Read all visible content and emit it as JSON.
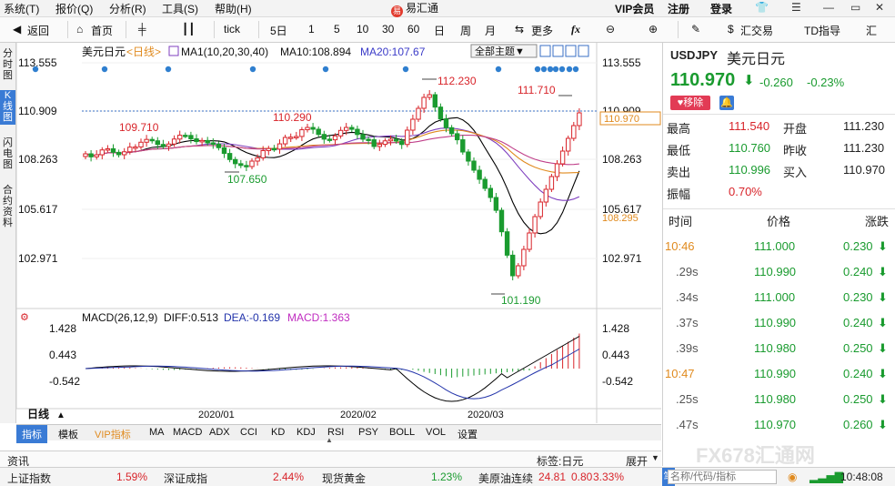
{
  "menubar": {
    "items": [
      "系统(T)",
      "报价(Q)",
      "分析(R)",
      "工具(S)",
      "帮助(H)"
    ],
    "brand": "易汇通",
    "vip": "VIP会员",
    "register": "注册",
    "login": "登录"
  },
  "toolbar": {
    "back": "返回",
    "home": "首页",
    "tick": "tick",
    "periods": [
      "5日",
      "1",
      "5",
      "10",
      "30",
      "60",
      "日",
      "周",
      "月"
    ],
    "more": "更多",
    "exchange": "汇交易",
    "td": "TD指导",
    "right_label": "汇"
  },
  "left_tabs": [
    "分时图",
    "K线图",
    "闪电图",
    "合约资料"
  ],
  "chart": {
    "title": "美元日元",
    "period": "<日线>",
    "ma_label": "MA1(10,20,30,40)",
    "ma10": "MA10:108.894",
    "ma20": "MA20:107.67",
    "theme_btn": "全部主题▼",
    "y_ticks": [
      "113.555",
      "110.909",
      "108.263",
      "105.617",
      "102.971"
    ],
    "current_price_tag": "110.970",
    "ma_tag": "108.295",
    "annotations": [
      "112.230",
      "111.710",
      "109.710",
      "110.290",
      "107.650",
      "101.190"
    ],
    "x_labels": [
      "2020/01",
      "2020/02",
      "2020/03"
    ],
    "macd_label": "MACD(26,12,9)",
    "macd_diff": "DIFF:0.513",
    "macd_dea": "DEA:-0.169",
    "macd_val": "MACD:1.363",
    "macd_ticks": [
      "1.428",
      "0.443",
      "-0.542"
    ],
    "day_tab": "日线",
    "colors": {
      "up": "#d8242a",
      "down": "#1a9b2f",
      "ma10": "#000000",
      "ma20": "#7f3fbf",
      "ma30": "#e08a1e",
      "ma40": "#c0408a",
      "diff": "#000000",
      "dea": "#2233aa"
    }
  },
  "indicator_tabs": [
    "指标",
    "模板",
    "VIP指标",
    "MA",
    "MACD",
    "ADX",
    "CCI",
    "KD",
    "KDJ",
    "RSI",
    "PSY",
    "BOLL",
    "VOL",
    "设置"
  ],
  "newsbar": {
    "left": "资讯",
    "right_label": "标签:日元",
    "expand": "展开"
  },
  "status": {
    "items": [
      {
        "name": "上证指数",
        "value": "1.59%"
      },
      {
        "name": "深证成指",
        "value": "2.44%"
      },
      {
        "name": "现货黄金",
        "value": "1.23%"
      },
      {
        "name": "美原油连续",
        "value": "24.81"
      },
      {
        "name": "",
        "value": "0.80"
      },
      {
        "name": "",
        "value": "3.33%"
      }
    ],
    "search_placeholder": "名称/代码/指标",
    "time": "10:48:08"
  },
  "quote": {
    "symbol": "USDJPY",
    "name": "美元日元",
    "price": "110.970",
    "change": "-0.260",
    "change_pct": "-0.23%",
    "remove": "移除",
    "rows": [
      {
        "l1": "最高",
        "v1": "111.540",
        "l2": "开盘",
        "v2": "111.230"
      },
      {
        "l1": "最低",
        "v1": "110.760",
        "l2": "昨收",
        "v2": "111.230"
      },
      {
        "l1": "卖出",
        "v1": "110.996",
        "l2": "买入",
        "v2": "110.970"
      },
      {
        "l1": "振幅",
        "v1": "0.70%",
        "l2": "",
        "v2": ""
      }
    ],
    "tick_headers": [
      "时间",
      "价格",
      "涨跌"
    ],
    "ticks": [
      {
        "time": "10:46",
        "price": "111.000",
        "chg": "0.230"
      },
      {
        "time": ".29s",
        "price": "110.990",
        "chg": "0.240"
      },
      {
        "time": ".34s",
        "price": "111.000",
        "chg": "0.230"
      },
      {
        "time": ".37s",
        "price": "110.990",
        "chg": "0.240"
      },
      {
        "time": ".39s",
        "price": "110.980",
        "chg": "0.250"
      },
      {
        "time": "10:47",
        "price": "110.990",
        "chg": "0.240"
      },
      {
        "time": ".25s",
        "price": "110.980",
        "chg": "0.250"
      },
      {
        "time": ".47s",
        "price": "110.970",
        "chg": "0.260"
      }
    ],
    "watermark": "FX678汇通网"
  }
}
